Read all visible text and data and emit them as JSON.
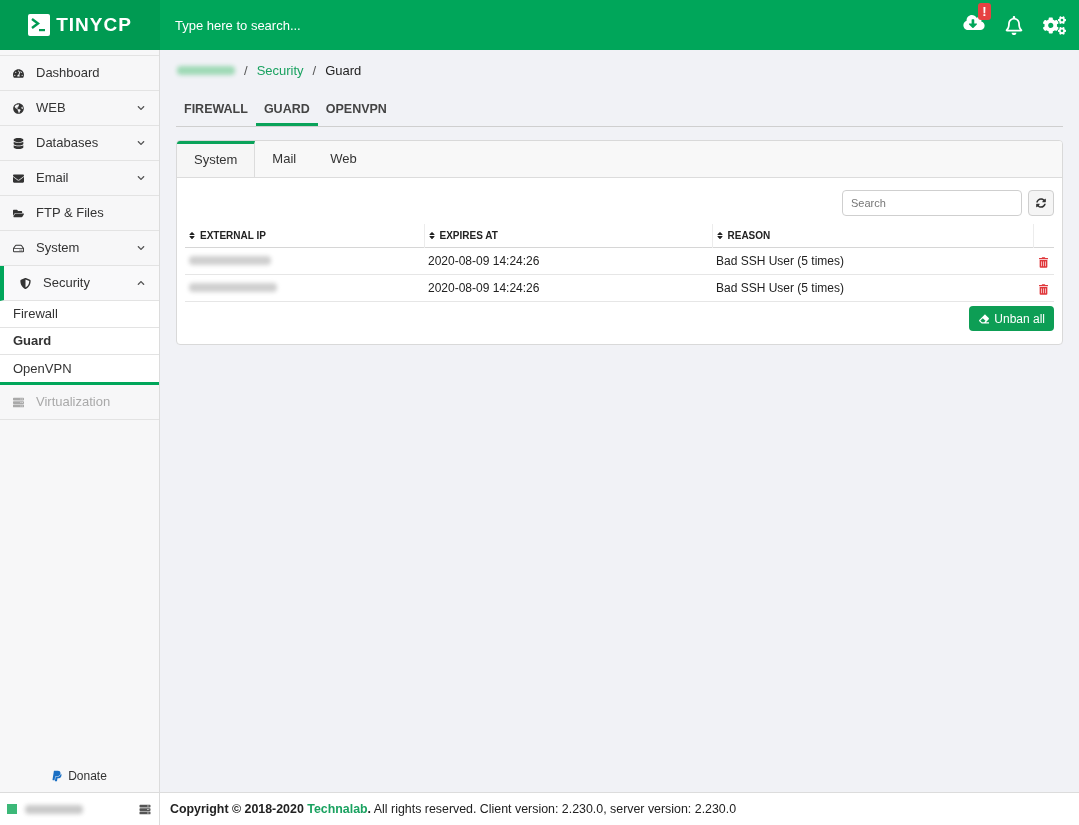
{
  "header": {
    "logo": "TINYCP",
    "search": {
      "placeholder": "Type here to search..."
    },
    "update_badge": "!"
  },
  "sidebar": {
    "items": [
      {
        "label": "Dashboard",
        "kind": "link",
        "selected": false,
        "disabled": false
      },
      {
        "label": "WEB",
        "kind": "group",
        "expanded": false,
        "selected": false,
        "disabled": false
      },
      {
        "label": "Databases",
        "kind": "group",
        "expanded": false,
        "selected": false,
        "disabled": false
      },
      {
        "label": "Email",
        "kind": "group",
        "expanded": false,
        "selected": false,
        "disabled": false
      },
      {
        "label": "FTP & Files",
        "kind": "link",
        "selected": false,
        "disabled": false
      },
      {
        "label": "System",
        "kind": "group",
        "expanded": false,
        "selected": false,
        "disabled": false
      },
      {
        "label": "Security",
        "kind": "group",
        "expanded": true,
        "selected": true,
        "disabled": false,
        "children": [
          {
            "label": "Firewall",
            "selected": false
          },
          {
            "label": "Guard",
            "selected": true
          },
          {
            "label": "OpenVPN",
            "selected": false
          }
        ]
      },
      {
        "label": "Virtualization",
        "kind": "link",
        "selected": false,
        "disabled": true
      }
    ],
    "donate": "Donate",
    "server": {
      "online": true
    }
  },
  "breadcrumb": [
    {
      "kind": "blurred"
    },
    {
      "kind": "link",
      "separator": "/",
      "label": "Security"
    },
    {
      "kind": "current",
      "separator": "/",
      "label": "Guard"
    }
  ],
  "tabs": [
    {
      "label": "FIREWALL",
      "selected": false
    },
    {
      "label": "GUARD",
      "selected": true
    },
    {
      "label": "OPENVPN",
      "selected": false
    }
  ],
  "card": {
    "tabs": [
      {
        "label": "System",
        "selected": true
      },
      {
        "label": "Mail",
        "selected": false
      },
      {
        "label": "Web",
        "selected": false
      }
    ],
    "search": {
      "placeholder": "Search"
    },
    "table": {
      "columns": [
        "EXTERNAL IP",
        "EXPIRES AT",
        "REASON"
      ],
      "rows": [
        {
          "expires_at": "2020-08-09 14:24:26",
          "reason": "Bad SSH User (5 times)"
        },
        {
          "expires_at": "2020-08-09 14:24:26",
          "reason": "Bad SSH User (5 times)"
        }
      ]
    },
    "unban_button": "Unban all"
  },
  "footer": {
    "copyright": "Copyright © 2018-2020",
    "link": "Technalab",
    "rest": "**.** All rights reserved. Client version: 2.230.0, server version: 2.230.0"
  }
}
